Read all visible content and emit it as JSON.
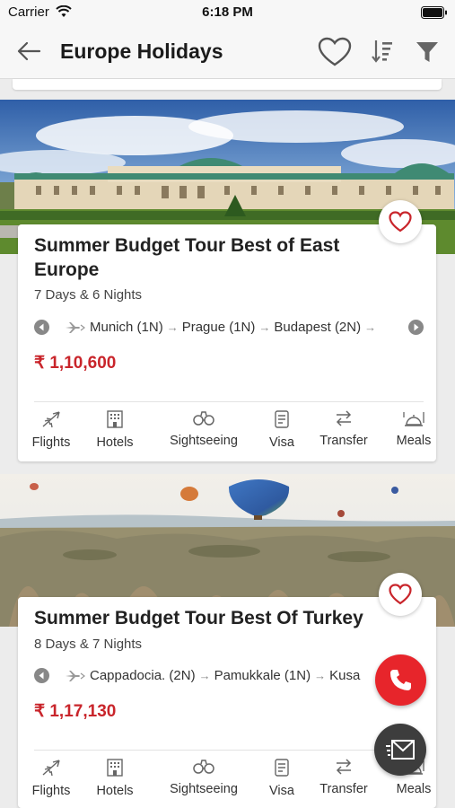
{
  "status_bar": {
    "carrier": "Carrier",
    "time": "6:18 PM"
  },
  "header": {
    "title": "Europe Holidays"
  },
  "packages": [
    {
      "title": "Summer Budget Tour Best of East Europe",
      "duration": "7 Days & 6 Nights",
      "route": [
        "Munich (1N)",
        "Prague (1N)",
        "Budapest (2N)"
      ],
      "price": "₹ 1,10,600"
    },
    {
      "title": "Summer Budget Tour Best Of Turkey",
      "duration": "8 Days & 7 Nights",
      "route": [
        "Cappadocia. (2N)",
        "Pamukkale (1N)",
        "Kusa"
      ],
      "price": "₹ 1,17,130"
    }
  ],
  "amenities": [
    "Flights",
    "Hotels",
    "Sightseeing",
    "Visa",
    "Transfer",
    "Meals"
  ],
  "colors": {
    "accent_red": "#c9252b",
    "call_button": "#e7252b",
    "mail_button": "#3d3d3d"
  },
  "icons": {
    "header": [
      "back-arrow-icon",
      "heart-icon",
      "sort-icon",
      "filter-icon"
    ],
    "amenities": [
      "plane-icon",
      "hotel-icon",
      "binoculars-icon",
      "visa-icon",
      "transfer-icon",
      "meal-icon"
    ],
    "floating": [
      "phone-icon",
      "envelope-icon"
    ]
  }
}
